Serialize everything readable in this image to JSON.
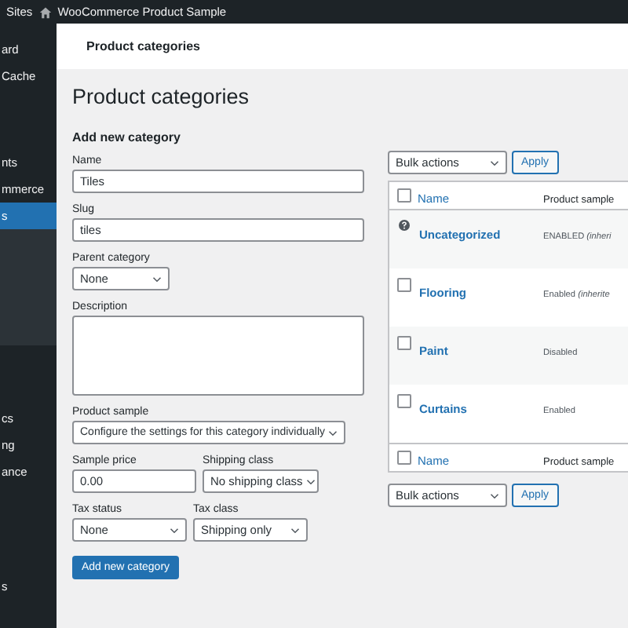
{
  "top_bar": {
    "site": "Sites",
    "title": "WooCommerce Product Sample"
  },
  "sidebar": {
    "groups": [
      [
        {
          "label": "ard",
          "selected": false
        },
        {
          "label": "Cache",
          "selected": false
        }
      ],
      [
        {
          "label": "nts",
          "selected": false
        },
        {
          "label": "mmerce",
          "selected": false
        },
        {
          "label": "s",
          "selected": true
        }
      ],
      [
        {
          "label": "cs",
          "selected": false
        },
        {
          "label": "ng",
          "selected": false
        },
        {
          "label": "ance",
          "selected": false
        }
      ],
      [
        {
          "label": "s",
          "selected": false
        }
      ]
    ]
  },
  "header": {
    "title": "Product categories"
  },
  "page_title": "Product categories",
  "form": {
    "heading": "Add new category",
    "name": {
      "label": "Name",
      "value": "Tiles"
    },
    "slug": {
      "label": "Slug",
      "value": "tiles"
    },
    "parent": {
      "label": "Parent category",
      "value": "None"
    },
    "description": {
      "label": "Description"
    },
    "product_sample": {
      "label": "Product sample",
      "value": "Configure the settings for this category individually"
    },
    "sample_price": {
      "label": "Sample price",
      "value": "0.00"
    },
    "shipping_class": {
      "label": "Shipping class",
      "value": "No shipping class"
    },
    "tax_status": {
      "label": "Tax status",
      "value": "None"
    },
    "tax_class": {
      "label": "Tax class",
      "value": "Shipping only"
    },
    "submit": "Add new category"
  },
  "bulk_top": {
    "select": "Bulk actions",
    "apply": "Apply"
  },
  "table": {
    "columns": [
      "Name",
      "Product sample"
    ],
    "rows": [
      {
        "kind": "help",
        "name": "Uncategorized",
        "sample": "ENABLED *(inheri*"
      },
      {
        "kind": "checkbox",
        "checked": false,
        "name": "Flooring",
        "sample": "Enabled *(inherite*"
      },
      {
        "kind": "checkbox",
        "checked": false,
        "name": "Paint",
        "sample": "Disabled"
      },
      {
        "kind": "checkbox",
        "checked": false,
        "name": "Curtains",
        "sample": "Enabled"
      }
    ],
    "header_checked": false,
    "footer_checked": false,
    "footer_columns": [
      "Name",
      "Product sample"
    ]
  },
  "bulk_bottom": {
    "select": "Bulk actions",
    "apply": "Apply"
  }
}
